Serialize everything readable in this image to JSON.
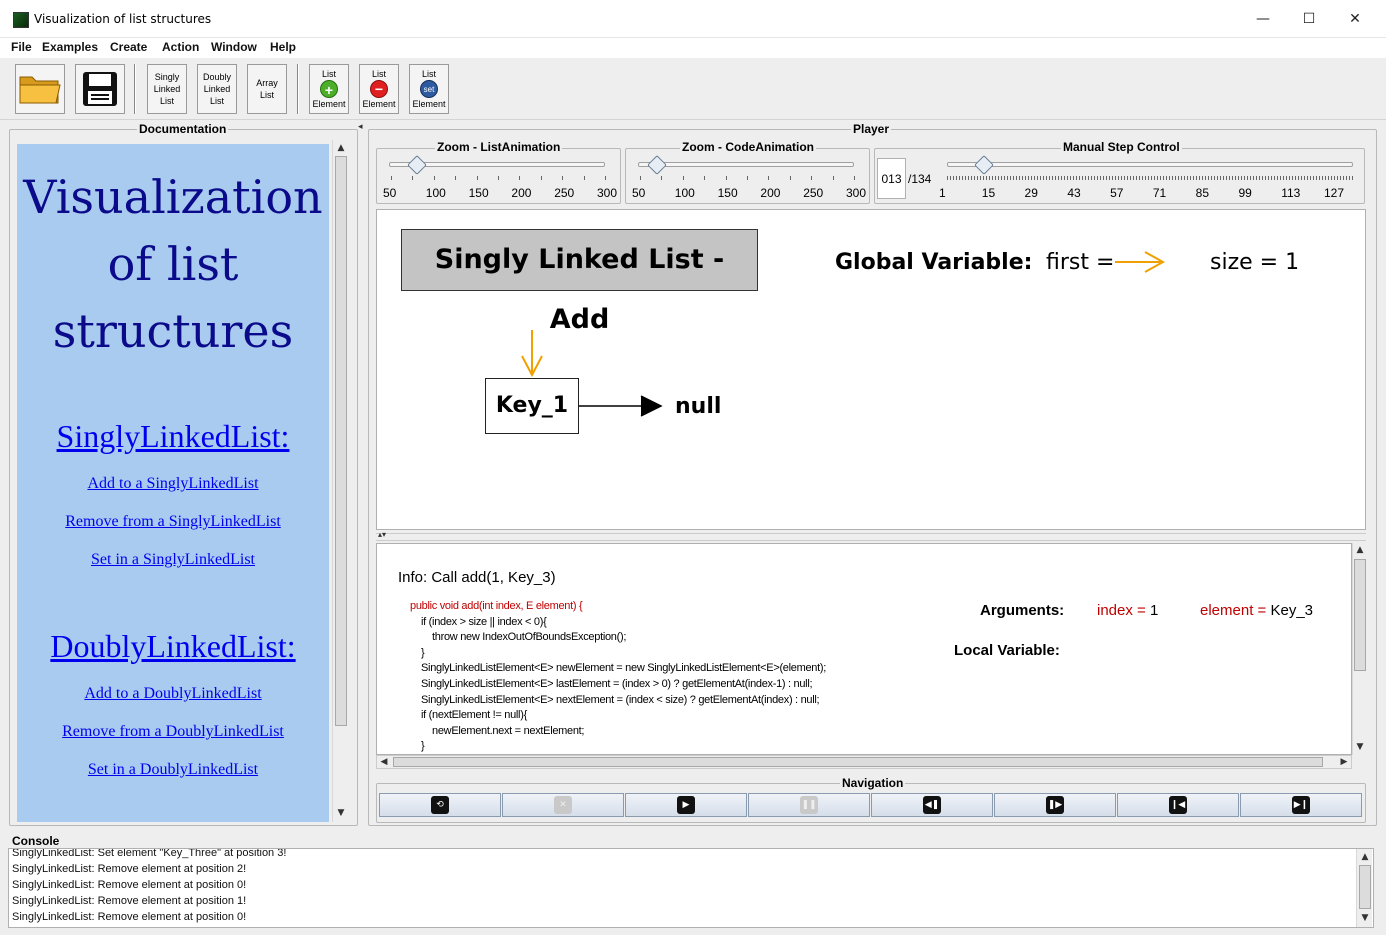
{
  "window": {
    "title": "Visualization of list structures",
    "minimize": "—",
    "maximize": "☐",
    "close": "✕"
  },
  "menu": [
    "File",
    "Examples",
    "Create",
    "Action",
    "Window",
    "Help"
  ],
  "toolbar": {
    "open_icon": "folder-icon",
    "save_icon": "floppy-disk-icon",
    "singly": [
      "Singly",
      "Linked",
      "List"
    ],
    "doubly": [
      "Doubly",
      "Linked",
      "List"
    ],
    "array": [
      "Array",
      "List"
    ],
    "add_element": {
      "top": "List",
      "bottom": "Element",
      "glyph": "+"
    },
    "remove_element": {
      "top": "List",
      "bottom": "Element",
      "glyph": "−"
    },
    "set_element": {
      "top": "List",
      "bottom": "Element",
      "glyph": "set"
    }
  },
  "documentation": {
    "title": "Documentation",
    "heading_lines": [
      "Visualization",
      "of list",
      "structures"
    ],
    "sections": [
      {
        "heading": "SinglyLinkedList:",
        "links": [
          "Add to a SinglyLinkedList",
          "Remove from a SinglyLinkedList",
          "Set in a SinglyLinkedList"
        ]
      },
      {
        "heading": "DoublyLinkedList:",
        "links": [
          "Add to a DoublyLinkedList",
          "Remove from a DoublyLinkedList",
          "Set in a DoublyLinkedList"
        ]
      }
    ]
  },
  "player": {
    "title": "Player",
    "zoom_list": {
      "label": "Zoom - ListAnimation",
      "ticks": [
        "50",
        "100",
        "150",
        "200",
        "250",
        "300"
      ],
      "value": 80
    },
    "zoom_code": {
      "label": "Zoom - CodeAnimation",
      "ticks": [
        "50",
        "100",
        "150",
        "200",
        "250",
        "300"
      ],
      "value": 70
    },
    "manual": {
      "label": "Manual Step Control",
      "step": "013",
      "total": "/134",
      "ticks": [
        "1",
        "15",
        "29",
        "43",
        "57",
        "71",
        "85",
        "99",
        "113",
        "127"
      ],
      "value": 13
    }
  },
  "animation": {
    "title": "Singly Linked List - Add",
    "global_label": "Global Variable:",
    "first_label": "first =",
    "size_label": "size = 1",
    "node_key": "Key_1",
    "null_label": "null"
  },
  "code": {
    "info": "Info: Call add(1, Key_3)",
    "lines": [
      "public void add(int index, E element) {",
      "    if (index > size || index < 0){",
      "        throw new IndexOutOfBoundsException();",
      "    }",
      "    SinglyLinkedListElement<E> newElement = new SinglyLinkedListElement<E>(element);",
      "    SinglyLinkedListElement<E> lastElement = (index > 0) ? getElementAt(index-1) : null;",
      "    SinglyLinkedListElement<E> nextElement = (index < size) ? getElementAt(index) : null;",
      "    if (nextElement != null){",
      "        newElement.next = nextElement;",
      "    }"
    ],
    "arguments_label": "Arguments:",
    "arg_index": "index = ",
    "arg_index_val": "1",
    "arg_element": "element = ",
    "arg_element_val": "Key_3",
    "local_label": "Local Variable:"
  },
  "navigation": {
    "title": "Navigation",
    "buttons": [
      {
        "name": "restart",
        "glyph": "⟲",
        "enabled": true
      },
      {
        "name": "stop",
        "glyph": "✕",
        "enabled": false
      },
      {
        "name": "play",
        "glyph": "▶",
        "enabled": true
      },
      {
        "name": "pause",
        "glyph": "❚❚",
        "enabled": false
      },
      {
        "name": "step-back",
        "glyph": "◀❚",
        "enabled": true
      },
      {
        "name": "step-forward",
        "glyph": "❚▶",
        "enabled": true
      },
      {
        "name": "skip-start",
        "glyph": "❙◀",
        "enabled": true
      },
      {
        "name": "skip-end",
        "glyph": "▶❙",
        "enabled": true
      }
    ]
  },
  "console": {
    "title": "Console",
    "lines": [
      "SinglyLinkedList: Set element \"Key_Three\" at position 3!",
      "SinglyLinkedList: Remove element at position 2!",
      "SinglyLinkedList: Remove element at position 0!",
      "SinglyLinkedList: Remove element at position 1!",
      "SinglyLinkedList: Remove element at position 0!"
    ]
  },
  "colors": {
    "doc_bg": "#a9cbf0",
    "link": "#0000ee",
    "arrow_orange": "#f0a000",
    "code_red": "#c00000"
  }
}
